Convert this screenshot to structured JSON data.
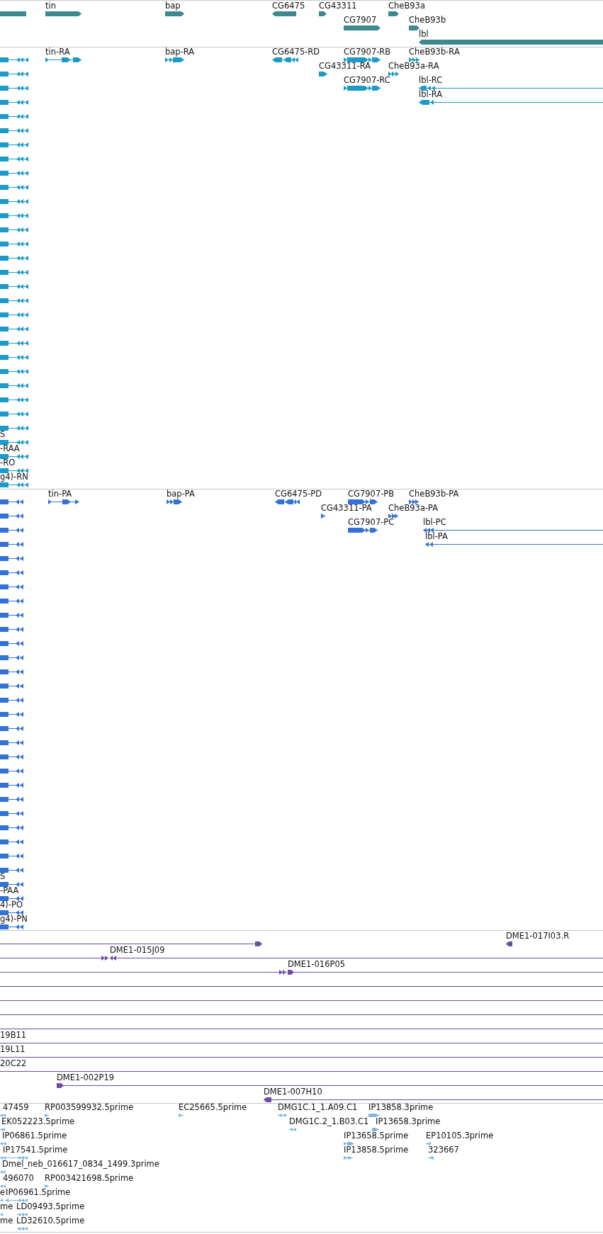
{
  "tracks": [
    {
      "kind": "gene",
      "color": "#3e898f",
      "rows": [
        {
          "features": [
            {
              "clipped": true
            },
            {
              "label": "tin",
              "reverse": false
            },
            {
              "label": "bap",
              "reverse": false
            },
            {
              "label": "CG6475",
              "reverse": true
            },
            {
              "label": "CG43311",
              "reverse": false
            },
            {
              "label": "CheB93a",
              "reverse": false
            }
          ]
        },
        {
          "features": [
            {
              "label": "CG7907",
              "reverse": false
            },
            {
              "label": "CheB93b",
              "reverse": false
            }
          ]
        },
        {
          "features": [
            {
              "label": "lbl",
              "reverse": true
            }
          ]
        }
      ]
    },
    {
      "kind": "transcript",
      "color": "#1c9bc8",
      "rows": [
        {
          "features": [
            {
              "reverse": true
            },
            {
              "label": "tin-RA",
              "reverse": false
            },
            {
              "label": "bap-RA",
              "reverse": false
            },
            {
              "label": "CG6475-RD",
              "reverse": true
            },
            {
              "label": "CG7907-RB",
              "reverse": false
            },
            {
              "label": "CheB93b-RA",
              "reverse": false
            }
          ]
        },
        {
          "features": [
            {
              "reverse": true
            },
            {
              "label": "CG43311-RA",
              "reverse": false
            },
            {
              "label": "CheB93a-RA",
              "reverse": false
            }
          ]
        },
        {
          "features": [
            {
              "reverse": true
            },
            {
              "label": "CG7907-RC",
              "reverse": false
            },
            {
              "label": "lbl-RC",
              "reverse": true
            }
          ]
        },
        {
          "features": [
            {
              "reverse": true
            },
            {
              "label": "lbl-RA",
              "reverse": true
            }
          ]
        },
        {
          "features": [
            {
              "reverse": true
            }
          ]
        },
        {
          "features": [
            {
              "reverse": true
            }
          ]
        },
        {
          "features": [
            {
              "reverse": true
            }
          ]
        },
        {
          "features": [
            {
              "reverse": true
            }
          ]
        },
        {
          "features": [
            {
              "reverse": true
            }
          ]
        },
        {
          "features": [
            {
              "reverse": true
            }
          ]
        },
        {
          "features": [
            {
              "reverse": true
            }
          ]
        },
        {
          "features": [
            {
              "reverse": true
            }
          ]
        },
        {
          "features": [
            {
              "reverse": true
            }
          ]
        },
        {
          "features": [
            {
              "reverse": true
            }
          ]
        },
        {
          "features": [
            {
              "reverse": true
            }
          ]
        },
        {
          "features": [
            {
              "reverse": true
            }
          ]
        },
        {
          "features": [
            {
              "reverse": true
            }
          ]
        },
        {
          "features": [
            {
              "reverse": true
            }
          ]
        },
        {
          "features": [
            {
              "reverse": true
            }
          ]
        },
        {
          "features": [
            {
              "reverse": true
            }
          ]
        },
        {
          "features": [
            {
              "reverse": true
            }
          ]
        },
        {
          "features": [
            {
              "reverse": true
            }
          ]
        },
        {
          "features": [
            {
              "reverse": true
            }
          ]
        },
        {
          "features": [
            {
              "reverse": true
            }
          ]
        },
        {
          "features": [
            {
              "reverse": true
            }
          ]
        },
        {
          "features": [
            {
              "reverse": true
            }
          ]
        },
        {
          "features": [
            {
              "reverse": true
            }
          ]
        },
        {
          "features": [
            {
              "label": "S",
              "reverse": true
            }
          ]
        },
        {
          "features": [
            {
              "label": "-RAA",
              "reverse": true
            }
          ]
        },
        {
          "features": [
            {
              "label": "-RO",
              "reverse": true
            }
          ]
        },
        {
          "features": [
            {
              "label": "g4)-RN",
              "reverse": true
            }
          ]
        }
      ]
    },
    {
      "kind": "transcript",
      "color": "#3372d4",
      "rows": [
        {
          "features": [
            {
              "reverse": true
            },
            {
              "label": "tin-PA",
              "reverse": false
            },
            {
              "label": "bap-PA",
              "reverse": false
            },
            {
              "label": "CG6475-PD",
              "reverse": true
            },
            {
              "label": "CG7907-PB",
              "reverse": false
            },
            {
              "label": "CheB93b-PA",
              "reverse": false
            }
          ]
        },
        {
          "features": [
            {
              "reverse": true
            },
            {
              "label": "CG43311-PA",
              "reverse": false
            },
            {
              "label": "CheB93a-PA",
              "reverse": false
            }
          ]
        },
        {
          "features": [
            {
              "reverse": true
            },
            {
              "label": "CG7907-PC",
              "reverse": false
            },
            {
              "label": "lbl-PC",
              "reverse": true
            }
          ]
        },
        {
          "features": [
            {
              "reverse": true
            },
            {
              "label": "lbl-PA",
              "reverse": true
            }
          ]
        },
        {
          "features": [
            {
              "reverse": true
            }
          ]
        },
        {
          "features": [
            {
              "reverse": true
            }
          ]
        },
        {
          "features": [
            {
              "reverse": true
            }
          ]
        },
        {
          "features": [
            {
              "reverse": true
            }
          ]
        },
        {
          "features": [
            {
              "reverse": true
            }
          ]
        },
        {
          "features": [
            {
              "reverse": true
            }
          ]
        },
        {
          "features": [
            {
              "reverse": true
            }
          ]
        },
        {
          "features": [
            {
              "reverse": true
            }
          ]
        },
        {
          "features": [
            {
              "reverse": true
            }
          ]
        },
        {
          "features": [
            {
              "reverse": true
            }
          ]
        },
        {
          "features": [
            {
              "reverse": true
            }
          ]
        },
        {
          "features": [
            {
              "reverse": true
            }
          ]
        },
        {
          "features": [
            {
              "reverse": true
            }
          ]
        },
        {
          "features": [
            {
              "reverse": true
            }
          ]
        },
        {
          "features": [
            {
              "reverse": true
            }
          ]
        },
        {
          "features": [
            {
              "reverse": true
            }
          ]
        },
        {
          "features": [
            {
              "reverse": true
            }
          ]
        },
        {
          "features": [
            {
              "reverse": true
            }
          ]
        },
        {
          "features": [
            {
              "reverse": true
            }
          ]
        },
        {
          "features": [
            {
              "reverse": true
            }
          ]
        },
        {
          "features": [
            {
              "reverse": true
            }
          ]
        },
        {
          "features": [
            {
              "reverse": true
            }
          ]
        },
        {
          "features": [
            {
              "reverse": true
            }
          ]
        },
        {
          "features": [
            {
              "label": "S",
              "reverse": true
            }
          ]
        },
        {
          "features": [
            {
              "label": "-PAA",
              "reverse": true
            }
          ]
        },
        {
          "features": [
            {
              "label": "4)-PO",
              "reverse": true
            }
          ]
        },
        {
          "features": [
            {
              "label": "g4)-PN",
              "reverse": true
            }
          ]
        }
      ]
    },
    {
      "kind": "clone",
      "color": "#6b4ea6",
      "rows": [
        {
          "features": [
            {
              "reverse": false
            },
            {
              "label": "DME1-017I03.R",
              "reverse": true
            }
          ]
        },
        {
          "features": [
            {
              "reverse": false
            },
            {
              "label": "DME1-015J09",
              "reverse": true
            }
          ]
        },
        {
          "features": [
            {
              "reverse": false
            },
            {
              "label": "DME1-016P05",
              "reverse": false
            }
          ]
        },
        {
          "features": [
            {
              "clipped": true
            }
          ]
        },
        {
          "features": [
            {
              "clipped": true
            }
          ]
        },
        {
          "features": [
            {
              "clipped": true
            }
          ]
        },
        {
          "features": [
            {
              "clipped": true
            }
          ]
        },
        {
          "features": [
            {
              "label": "19B11"
            }
          ]
        },
        {
          "features": [
            {
              "label": "19L11"
            }
          ]
        },
        {
          "features": [
            {
              "label": "20C22"
            }
          ]
        },
        {
          "features": [
            {
              "label": "DME1-002P19",
              "reverse": false
            }
          ]
        },
        {
          "features": [
            {
              "label": "DME1-007H10",
              "reverse": true
            }
          ]
        }
      ]
    },
    {
      "kind": "est",
      "color": "#82b6df",
      "rows": [
        {
          "features": [
            {
              "label": "47459",
              "reverse": true
            },
            {
              "label": "RP003599932.5prime",
              "reverse": false
            },
            {
              "label": "EC25665.5prime",
              "reverse": false
            },
            {
              "label": "DMG1C.1_1.A09.C1",
              "reverse": true
            },
            {
              "label": "IP13858.3prime",
              "reverse": false
            }
          ]
        },
        {
          "features": [
            {
              "label": "EK052223.5prime",
              "reverse": true
            },
            {
              "label": "DMG1C.2_1.B03.C1",
              "reverse": true
            },
            {
              "label": "IP13658.3prime",
              "reverse": false
            }
          ]
        },
        {
          "features": [
            {
              "label": "IP06861.5prime",
              "reverse": true
            },
            {
              "label": "IP13658.5prime",
              "reverse": false
            },
            {
              "label": "EP10105.3prime",
              "reverse": true
            }
          ]
        },
        {
          "features": [
            {
              "label": "IP17541.5prime",
              "reverse": true
            },
            {
              "label": "IP13858.5prime",
              "reverse": false
            },
            {
              "label": "323667",
              "reverse": true
            }
          ]
        },
        {
          "features": [
            {
              "label": "Dmel_neb_016617_0834_1499.3prime",
              "reverse": true
            }
          ]
        },
        {
          "features": [
            {
              "label": "496070",
              "reverse": true
            },
            {
              "label": "RP003421698.5prime",
              "reverse": false
            }
          ]
        },
        {
          "features": [
            {
              "label": "e",
              "reverse": true
            },
            {
              "label": "IP06961.5prime",
              "reverse": true
            }
          ]
        },
        {
          "features": [
            {
              "label": "me",
              "reverse": true
            },
            {
              "label": "LD09493.5prime",
              "reverse": true
            }
          ]
        },
        {
          "features": [
            {
              "label": "me"
            },
            {
              "label": "LD32610.5prime",
              "reverse": true
            }
          ]
        }
      ]
    }
  ]
}
